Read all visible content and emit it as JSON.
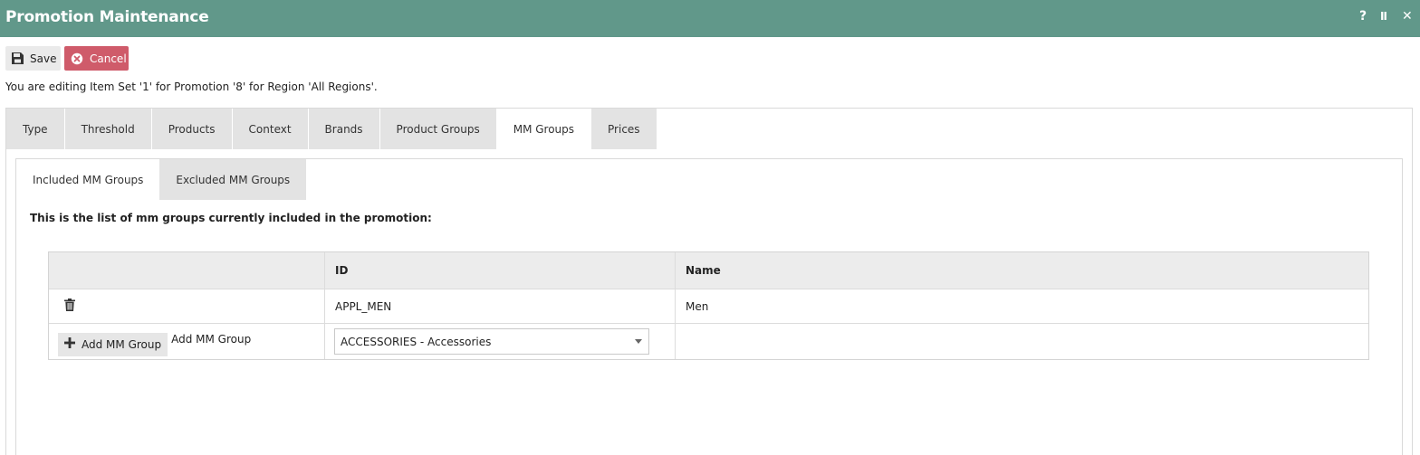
{
  "window": {
    "title": "Promotion Maintenance",
    "help": "?",
    "pause": "II",
    "close": "✕"
  },
  "toolbar": {
    "save_label": "Save",
    "cancel_label": "Cancel"
  },
  "edit_message": "You are editing Item Set '1' for Promotion '8' for Region 'All Regions'.",
  "tabs": [
    {
      "label": "Type"
    },
    {
      "label": "Threshold"
    },
    {
      "label": "Products"
    },
    {
      "label": "Context"
    },
    {
      "label": "Brands"
    },
    {
      "label": "Product Groups"
    },
    {
      "label": "MM Groups",
      "active": true
    },
    {
      "label": "Prices"
    }
  ],
  "subtabs": [
    {
      "label": "Included MM Groups",
      "active": true
    },
    {
      "label": "Excluded MM Groups"
    }
  ],
  "list_description": "This is the list of mm groups currently included in the promotion:",
  "table": {
    "columns": [
      "",
      "ID",
      "Name"
    ],
    "rows": [
      {
        "id": "APPL_MEN",
        "name": "Men"
      }
    ]
  },
  "add_row": {
    "button_label": "Add MM Group",
    "label": "Add MM Group",
    "select_value": "ACCESSORIES - Accessories"
  },
  "colors": {
    "header": "#61988a",
    "cancel": "#cf5b6a"
  }
}
